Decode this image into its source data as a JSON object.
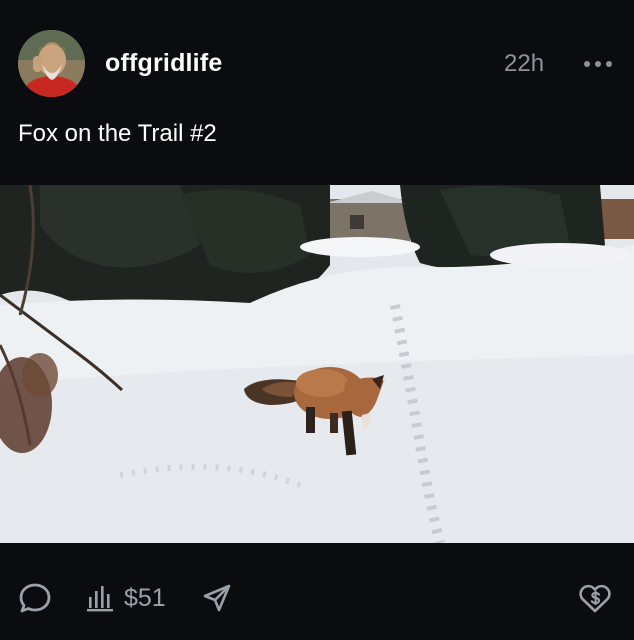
{
  "post": {
    "author": "offgridlife",
    "time": "22h",
    "title": "Fox on the Trail #2"
  },
  "media": {
    "description_icon": "photo"
  },
  "actions": {
    "tip_amount": "$51"
  },
  "icons": {
    "comment": "comment-icon",
    "stats": "bar-chart-icon",
    "share": "send-icon",
    "tip_heart": "heart-dollar-icon",
    "more": "more-dots-icon"
  },
  "colors": {
    "background": "#0b0c0f",
    "muted": "#8e939b",
    "text": "#ffffff"
  }
}
